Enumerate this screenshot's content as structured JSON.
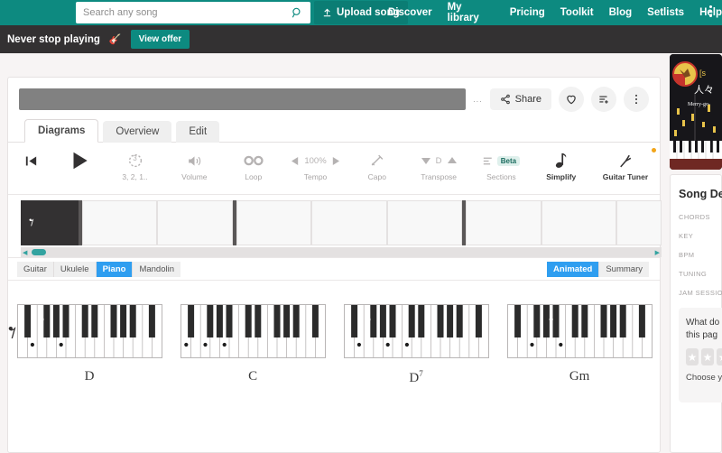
{
  "topnav": {
    "search_placeholder": "Search any song",
    "search_value": "",
    "search_icon": "search-icon",
    "upload_label": "Upload song",
    "upload_icon": "upload-icon",
    "links": [
      "Discover",
      "My library",
      "Pricing",
      "Toolkit",
      "Blog",
      "Setlists",
      "Help"
    ],
    "menu_icon": "kebab-menu-icon",
    "bg_color": "#0d8a80"
  },
  "promo": {
    "text": "Never stop playing",
    "emoji": "guitar-emoji",
    "button_label": "View offer",
    "bg_color": "#333132",
    "accent_color": "#0d8a80"
  },
  "song_header": {
    "title_placeholder": "",
    "trailing_dots": "...",
    "share_label": "Share",
    "share_icon": "share-icon",
    "favorite_icon": "heart-icon",
    "playlist_icon": "add-to-playlist-icon",
    "more_icon": "more-vertical-icon"
  },
  "tabs": [
    {
      "label": "Diagrams",
      "active": true
    },
    {
      "label": "Overview",
      "active": false
    },
    {
      "label": "Edit",
      "active": false
    }
  ],
  "controls": [
    {
      "name": "rewind",
      "label": "",
      "icon": "skip-back-icon",
      "dark": true
    },
    {
      "name": "play",
      "label": "",
      "icon": "play-icon",
      "dark": true
    },
    {
      "name": "countin",
      "label": "3, 2, 1..",
      "icon": "countdown-icon",
      "dark": false
    },
    {
      "name": "volume",
      "label": "Volume",
      "icon": "speaker-icon",
      "dark": false
    },
    {
      "name": "loop",
      "label": "Loop",
      "icon": "infinity-icon",
      "dark": false
    },
    {
      "name": "tempo",
      "label": "Tempo",
      "icon": "tempo-stepper",
      "value": "100%",
      "dark": false
    },
    {
      "name": "capo",
      "label": "Capo",
      "icon": "capo-icon",
      "dark": false
    },
    {
      "name": "transpose",
      "label": "Transpose",
      "icon": "transpose-stepper",
      "value": "D",
      "dark": false
    },
    {
      "name": "sections",
      "label": "Sections",
      "icon": "sections-icon",
      "badge": "Beta",
      "dark": false
    },
    {
      "name": "simplify",
      "label": "Simplify",
      "icon": "note-icon",
      "dark": true
    },
    {
      "name": "tuner",
      "label": "Guitar Tuner",
      "icon": "tuning-fork-icon",
      "dot": true,
      "dark": true
    }
  ],
  "timeline": {
    "first_measure_glyph": "quarter-rest",
    "measure_count": 9,
    "scroll_thumb_color": "#33a3a0"
  },
  "instruments": {
    "items": [
      {
        "label": "Guitar",
        "active": false
      },
      {
        "label": "Ukulele",
        "active": false
      },
      {
        "label": "Piano",
        "active": true
      },
      {
        "label": "Mandolin",
        "active": false
      }
    ],
    "view_modes": [
      {
        "label": "Animated",
        "active": true
      },
      {
        "label": "Summary",
        "active": false
      }
    ],
    "active_color": "#2f9ef0"
  },
  "diagram_panel": {
    "lead_glyph": "quarter-rest",
    "chords": [
      {
        "name": "D",
        "superscript": "",
        "white_dots": [
          1,
          4
        ],
        "black_dots": [
          2
        ],
        "black_layout": [
          1,
          1,
          0,
          1,
          1,
          1,
          0,
          1,
          1,
          0,
          1,
          1,
          1
        ]
      },
      {
        "name": "C",
        "superscript": "",
        "white_dots": [
          0,
          2,
          4
        ],
        "black_dots": [],
        "black_layout": [
          1,
          1,
          0,
          1,
          1,
          1,
          0,
          1,
          1,
          0,
          1,
          1,
          1
        ]
      },
      {
        "name": "D",
        "superscript": "7",
        "white_dots": [
          1,
          4,
          6
        ],
        "black_dots": [
          2
        ],
        "black_layout": [
          1,
          1,
          0,
          1,
          1,
          1,
          0,
          1,
          1,
          0,
          1,
          1,
          1
        ]
      },
      {
        "name": "Gm",
        "superscript": "",
        "white_dots": [
          2,
          5
        ],
        "black_dots": [
          4
        ],
        "black_layout": [
          1,
          1,
          0,
          1,
          1,
          1,
          0,
          1,
          1,
          0,
          1,
          1,
          1
        ]
      }
    ]
  },
  "album_art": {
    "title_cn": "人々",
    "subtitle": "Merry-go-",
    "badge": "[s"
  },
  "song_details": {
    "heading": "Song Det",
    "fields": [
      "CHORDS",
      "KEY",
      "BPM",
      "TUNING",
      "JAM SESSION"
    ],
    "feedback": {
      "question_line1": "What do",
      "question_line2": "this pag",
      "stars": 5,
      "hint": "Choose y"
    }
  }
}
